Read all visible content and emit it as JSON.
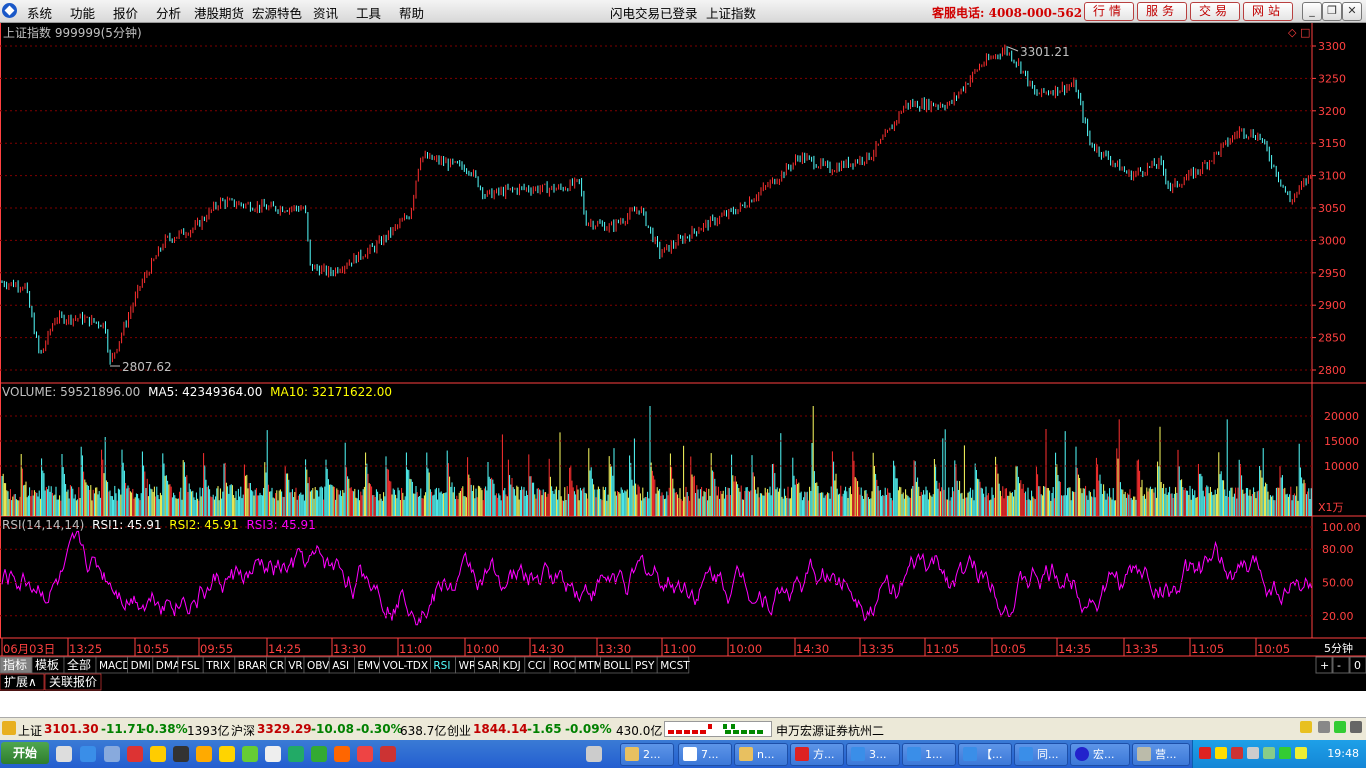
{
  "menubar": {
    "items": [
      "系统",
      "功能",
      "报价",
      "分析",
      "港股期货",
      "宏源特色",
      "资讯",
      "工具",
      "帮助"
    ],
    "login_status": "闪电交易已登录",
    "index_name": "上证指数",
    "hotline": "客服电话: 4008-000-562",
    "buttons": [
      "行情",
      "服务",
      "交易",
      "网站"
    ]
  },
  "price_panel": {
    "title": "上证指数 999999(5分钟)",
    "y_ticks": [
      "3300",
      "3250",
      "3200",
      "3150",
      "3100",
      "3050",
      "3000",
      "2950",
      "2900",
      "2850",
      "2800"
    ],
    "high_label": "3301.21",
    "low_label": "2807.62"
  },
  "volume_panel": {
    "vol_label": "VOLUME: 59521896.00",
    "ma5_label": "MA5: 42349364.00",
    "ma10_label": "MA10: 32171622.00",
    "y_ticks": [
      "20000",
      "15000",
      "10000"
    ],
    "unit": "X1万"
  },
  "rsi_panel": {
    "name": "RSI(14,14,14)",
    "rsi1": "RSI1: 45.91",
    "rsi2": "RSI2: 45.91",
    "rsi3": "RSI3: 45.91",
    "y_ticks": [
      "100.00",
      "80.00",
      "50.00",
      "20.00"
    ]
  },
  "time_axis": {
    "labels": [
      "06月03日",
      "13:25",
      "10:55",
      "09:55",
      "14:25",
      "13:30",
      "11:00",
      "10:00",
      "14:30",
      "13:30",
      "11:00",
      "10:00",
      "14:30",
      "13:35",
      "11:05",
      "10:05",
      "14:35",
      "13:35",
      "11:05",
      "10:05"
    ],
    "period": "5分钟"
  },
  "indicator_tabs": [
    "指标",
    "模板",
    "全部",
    "MACD",
    "DMI",
    "DMA",
    "FSL",
    "TRIX",
    "BRAR",
    "CR",
    "VR",
    "OBV",
    "ASI",
    "EMV",
    "VOL-TDX",
    "RSI",
    "WR",
    "SAR",
    "KDJ",
    "CCI",
    "ROC",
    "MTM",
    "BOLL",
    "PSY",
    "MCST"
  ],
  "active_tab": "RSI",
  "tab_controls": [
    "+",
    "-",
    "0"
  ],
  "sub_tabs": [
    "扩展∧",
    "关联报价"
  ],
  "status": {
    "sh_label": "上证",
    "sh_value": "3101.30",
    "sh_chg": "-11.71",
    "sh_pct": "-0.38%",
    "sh_amt": "1393亿",
    "hs_label": "沪深",
    "hs_value": "3329.29",
    "hs_chg": "-10.08",
    "hs_pct": "-0.30%",
    "hs_amt": "638.7亿",
    "cy_label": "创业",
    "cy_value": "1844.14",
    "cy_chg": "-1.65",
    "cy_pct": "-0.09%",
    "cy_amt": "430.0亿",
    "broker": "申万宏源证券杭州二"
  },
  "taskbar": {
    "start": "开始",
    "tasks": [
      "2...",
      "7...",
      "n...",
      "方...",
      "3...",
      "1...",
      "【...",
      "同...",
      "宏...",
      "营..."
    ],
    "clock": "19:48"
  },
  "colors": {
    "up": "#ff3030",
    "down": "#54ffff",
    "ma5": "#ffffff",
    "ma10": "#ffff00",
    "rsi": "#ff00ff",
    "grid": "#800000",
    "axis": "#ff4040"
  }
}
